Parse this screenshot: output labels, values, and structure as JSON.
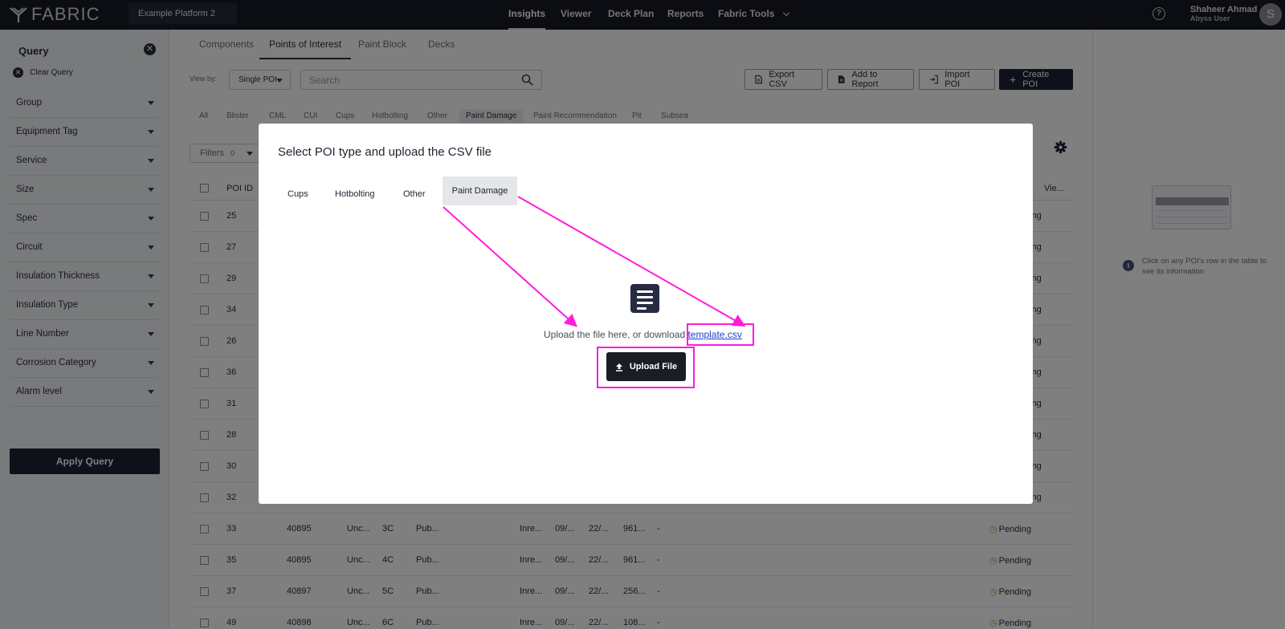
{
  "topbar": {
    "brand": "FABRIC",
    "platform": "Example Platform 2",
    "nav": [
      "Insights",
      "Viewer",
      "Deck Plan",
      "Reports",
      "Fabric Tools"
    ],
    "help": "?",
    "user_name": "Shaheer Ahmad",
    "user_role": "Abyss User",
    "avatar": "S"
  },
  "sidebar": {
    "title": "Query",
    "clear": "Clear Query",
    "filters": [
      "Group",
      "Equipment Tag",
      "Service",
      "Size",
      "Spec",
      "Circuit",
      "Insulation Thickness",
      "Insulation Type",
      "Line Number",
      "Corrosion Category",
      "Alarm level"
    ],
    "apply": "Apply Query"
  },
  "main": {
    "tabs": [
      "Components",
      "Points of Interest",
      "Paint Block",
      "Decks"
    ],
    "view_by": "View by:",
    "view_value": "Single POI",
    "search_placeholder": "Search",
    "buttons": [
      "Export CSV",
      "Add to Report",
      "Import POI",
      "Create POI"
    ],
    "chips": [
      "All",
      "Blister",
      "CML",
      "CUI",
      "Cups",
      "Hotbolting",
      "Other",
      "Paint Damage",
      "Paint Recommendation",
      "Pit",
      "Subsea"
    ],
    "filters_label": "Filters",
    "filters_count": "0",
    "col_poi": "POI ID",
    "col_view": "Vie...",
    "status_frag": "ding",
    "rows_behind": [
      "25",
      "27",
      "29",
      "34",
      "26",
      "36",
      "31",
      "28",
      "30",
      "32"
    ],
    "rows_visible": [
      {
        "id": "33",
        "c2": "40895",
        "c3": "Unc...",
        "c4": "3C",
        "c5": "Pub...",
        "c6": "Inre...",
        "c7": "09/...",
        "c8": "22/...",
        "c9": "961...",
        "c10": "-",
        "status": "Pending"
      },
      {
        "id": "35",
        "c2": "40895",
        "c3": "Unc...",
        "c4": "4C",
        "c5": "Pub...",
        "c6": "Inre...",
        "c7": "09/...",
        "c8": "22/...",
        "c9": "961...",
        "c10": "-",
        "status": "Pending"
      },
      {
        "id": "37",
        "c2": "40897",
        "c3": "Unc...",
        "c4": "5C",
        "c5": "Pub...",
        "c6": "Inre...",
        "c7": "09/...",
        "c8": "22/...",
        "c9": "256...",
        "c10": "-",
        "status": "Pending"
      },
      {
        "id": "49",
        "c2": "40898",
        "c3": "Unc...",
        "c4": "6C",
        "c5": "Pub...",
        "c6": "Inre...",
        "c7": "09/...",
        "c8": "22/...",
        "c9": "108...",
        "c10": "-",
        "status": "Pending"
      }
    ]
  },
  "right_pane": {
    "info": "Click on any POI's row in the table to see its information"
  },
  "modal": {
    "title": "Select POI type and upload the CSV file",
    "tabs": [
      "Cups",
      "Hotbolting",
      "Other",
      "Paint Damage"
    ],
    "upload_text": "Upload the file here, or download ",
    "template_link": "template.csv",
    "upload_button": "Upload File"
  },
  "colors": {
    "primary": "#1d2035",
    "annotation": "#ff1cdc",
    "link": "#1f3dc9",
    "pending": "#d98a2b"
  }
}
